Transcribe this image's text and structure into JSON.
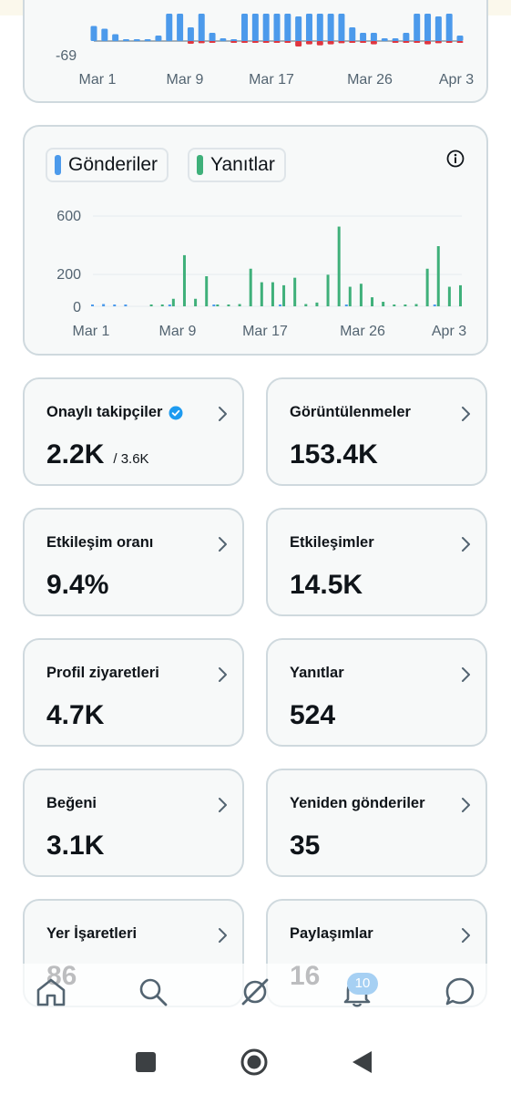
{
  "colors": {
    "posts_blue": "#4c9aeb",
    "replies_green": "#3fb07a",
    "negative_red": "#e0363f",
    "verified_blue": "#1d9bf0",
    "muted_text": "#536471",
    "badge_bg": "#a6d0f3"
  },
  "charts": [
    {
      "id": "top-partial-chart",
      "type": "bar",
      "y_min_label": "-69",
      "x_tick_labels": [
        "Mar 1",
        "Mar 9",
        "Mar 17",
        "Mar 26",
        "Apr 3"
      ],
      "note_values_scaled_visual": true,
      "bars": [
        {
          "up": 0.55,
          "down": 0.0
        },
        {
          "up": 0.45,
          "down": 0.0
        },
        {
          "up": 0.25,
          "down": 0.0
        },
        {
          "up": 0.05,
          "down": 0.0
        },
        {
          "up": 0.05,
          "down": 0.0
        },
        {
          "up": 0.05,
          "down": 0.0
        },
        {
          "up": 0.2,
          "down": 0.0
        },
        {
          "up": 1.0,
          "down": 0.0
        },
        {
          "up": 1.0,
          "down": 0.0
        },
        {
          "up": 0.5,
          "down": 0.25
        },
        {
          "up": 1.0,
          "down": 0.2
        },
        {
          "up": 0.3,
          "down": 0.1
        },
        {
          "up": 0.1,
          "down": 0.0
        },
        {
          "up": 0.05,
          "down": 0.1
        },
        {
          "up": 1.0,
          "down": 0.1
        },
        {
          "up": 1.0,
          "down": 0.1
        },
        {
          "up": 1.0,
          "down": 0.15
        },
        {
          "up": 1.0,
          "down": 0.1
        },
        {
          "up": 1.0,
          "down": 0.1
        },
        {
          "up": 0.9,
          "down": 0.5
        },
        {
          "up": 1.0,
          "down": 0.3
        },
        {
          "up": 1.0,
          "down": 0.4
        },
        {
          "up": 1.0,
          "down": 0.3
        },
        {
          "up": 1.0,
          "down": 0.2
        },
        {
          "up": 0.5,
          "down": 0.15
        },
        {
          "up": 0.3,
          "down": 0.05
        },
        {
          "up": 0.3,
          "down": 0.3
        },
        {
          "up": 0.1,
          "down": 0.0
        },
        {
          "up": 0.1,
          "down": 0.15
        },
        {
          "up": 0.3,
          "down": 0.1
        },
        {
          "up": 1.0,
          "down": 0.1
        },
        {
          "up": 1.0,
          "down": 0.3
        },
        {
          "up": 0.9,
          "down": 0.2
        },
        {
          "up": 1.0,
          "down": 0.15
        },
        {
          "up": 0.2,
          "down": 0.05
        }
      ]
    }
  ],
  "chart_data": {
    "type": "bar",
    "legend": [
      "Gönderiler",
      "Yanıtlar"
    ],
    "y_tick_labels": [
      "600",
      "200",
      "0"
    ],
    "ylim": [
      0,
      650
    ],
    "x_tick_labels": [
      "Mar 1",
      "Mar 9",
      "Mar 17",
      "Mar 26",
      "Apr 3"
    ],
    "categories": [
      "Mar 1",
      "Mar 2",
      "Mar 3",
      "Mar 4",
      "Mar 5",
      "Mar 6",
      "Mar 7",
      "Mar 8",
      "Mar 9",
      "Mar 10",
      "Mar 11",
      "Mar 12",
      "Mar 13",
      "Mar 14",
      "Mar 15",
      "Mar 16",
      "Mar 17",
      "Mar 18",
      "Mar 19",
      "Mar 20",
      "Mar 21",
      "Mar 22",
      "Mar 23",
      "Mar 24",
      "Mar 25",
      "Mar 26",
      "Mar 27",
      "Mar 28",
      "Mar 29",
      "Mar 30",
      "Mar 31",
      "Apr 1",
      "Apr 2",
      "Apr 3"
    ],
    "series": [
      {
        "name": "Gönderiler",
        "values": [
          10,
          15,
          10,
          5,
          0,
          0,
          0,
          5,
          0,
          0,
          0,
          5,
          0,
          0,
          0,
          0,
          0,
          5,
          0,
          0,
          0,
          0,
          0,
          5,
          0,
          0,
          0,
          0,
          0,
          0,
          0,
          5,
          0,
          0
        ]
      },
      {
        "name": "Yanıtlar",
        "values": [
          0,
          0,
          0,
          0,
          0,
          5,
          10,
          50,
          340,
          50,
          200,
          10,
          5,
          15,
          250,
          160,
          160,
          140,
          190,
          15,
          25,
          210,
          530,
          130,
          150,
          60,
          30,
          5,
          5,
          15,
          250,
          400,
          130,
          140
        ]
      }
    ]
  },
  "info_icon": "info-icon",
  "stats": [
    {
      "label": "Onaylı takipçiler",
      "value": "2.2K",
      "sub": "/ 3.6K",
      "verified": true
    },
    {
      "label": "Görüntülenmeler",
      "value": "153.4K"
    },
    {
      "label": "Etkileşim oranı",
      "value": "9.4%"
    },
    {
      "label": "Etkileşimler",
      "value": "14.5K"
    },
    {
      "label": "Profil ziyaretleri",
      "value": "4.7K"
    },
    {
      "label": "Yanıtlar",
      "value": "524"
    },
    {
      "label": "Beğeni",
      "value": "3.1K"
    },
    {
      "label": "Yeniden gönderiler",
      "value": "35"
    },
    {
      "label": "Yer İşaretleri",
      "value": "86"
    },
    {
      "label": "Paylaşımlar",
      "value": "16"
    }
  ],
  "nav": {
    "items": [
      "home-icon",
      "search-icon",
      "grok-icon",
      "notifications-icon",
      "messages-icon"
    ],
    "notification_badge": "10"
  },
  "system_nav": [
    "recents-button",
    "home-button",
    "back-button"
  ]
}
